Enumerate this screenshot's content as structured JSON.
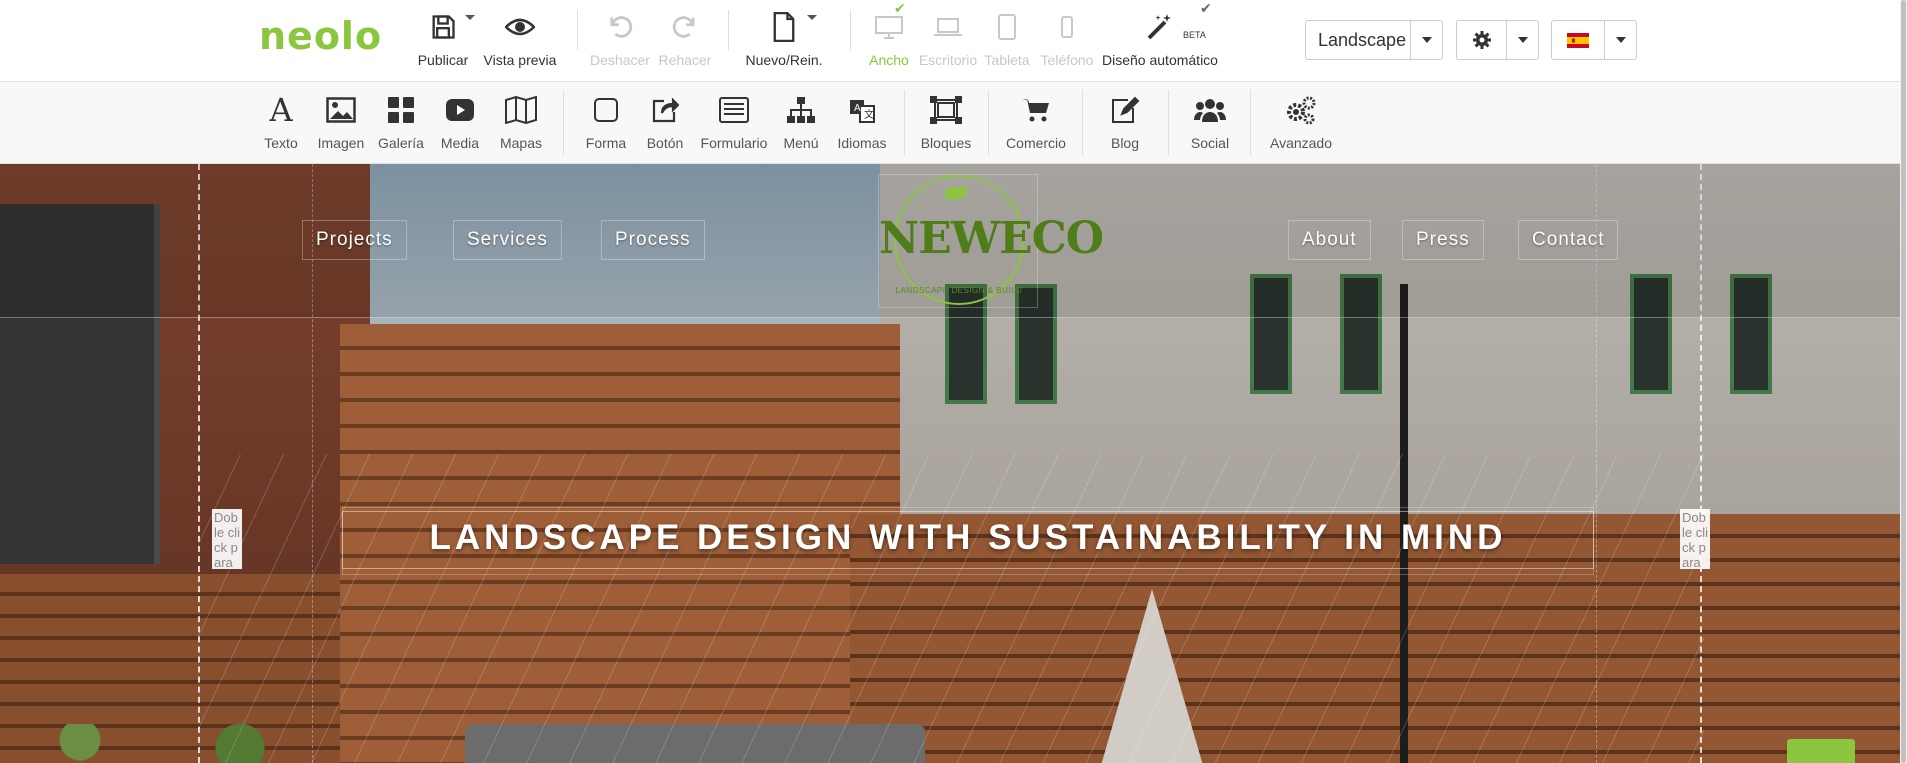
{
  "app": {
    "logo": "neolo"
  },
  "toolbar": {
    "publish": "Publicar",
    "preview": "Vista previa",
    "undo": "Deshacer",
    "redo": "Rehacer",
    "new_reinit": "Nuevo/Rein.",
    "devices": {
      "wide": "Ancho",
      "desktop": "Escritorio",
      "tablet": "Tableta",
      "phone": "Teléfono"
    },
    "auto_design": "Diseño automático",
    "beta_badge": "BETA",
    "page_select": "Landscape",
    "language_flag": "es-flag"
  },
  "toolbox": {
    "items": [
      {
        "label": "Texto",
        "icon": "text-icon"
      },
      {
        "label": "Imagen",
        "icon": "image-icon"
      },
      {
        "label": "Galería",
        "icon": "gallery-icon"
      },
      {
        "label": "Media",
        "icon": "video-icon"
      },
      {
        "label": "Mapas",
        "icon": "map-icon"
      },
      {
        "label": "Forma",
        "icon": "shape-icon"
      },
      {
        "label": "Botón",
        "icon": "button-icon"
      },
      {
        "label": "Formulario",
        "icon": "form-icon"
      },
      {
        "label": "Menú",
        "icon": "menu-icon"
      },
      {
        "label": "Idiomas",
        "icon": "languages-icon"
      },
      {
        "label": "Bloques",
        "icon": "blocks-icon"
      },
      {
        "label": "Comercio",
        "icon": "cart-icon"
      },
      {
        "label": "Blog",
        "icon": "blog-icon"
      },
      {
        "label": "Social",
        "icon": "social-icon"
      },
      {
        "label": "Avanzado",
        "icon": "gears-icon"
      }
    ]
  },
  "site": {
    "nav": [
      "Projects",
      "Services",
      "Process",
      "About",
      "Press",
      "Contact"
    ],
    "logo_name": "NEWECO",
    "logo_tagline": "LANDSCAPE DESIGN & BUILD",
    "hero_title": "LANDSCAPE DESIGN WITH SUSTAINABILITY IN MIND",
    "dblclick_hint": "Doble click para centrar"
  },
  "colors": {
    "brand_green": "#8cc63f",
    "disabled": "#c8c8c8"
  }
}
